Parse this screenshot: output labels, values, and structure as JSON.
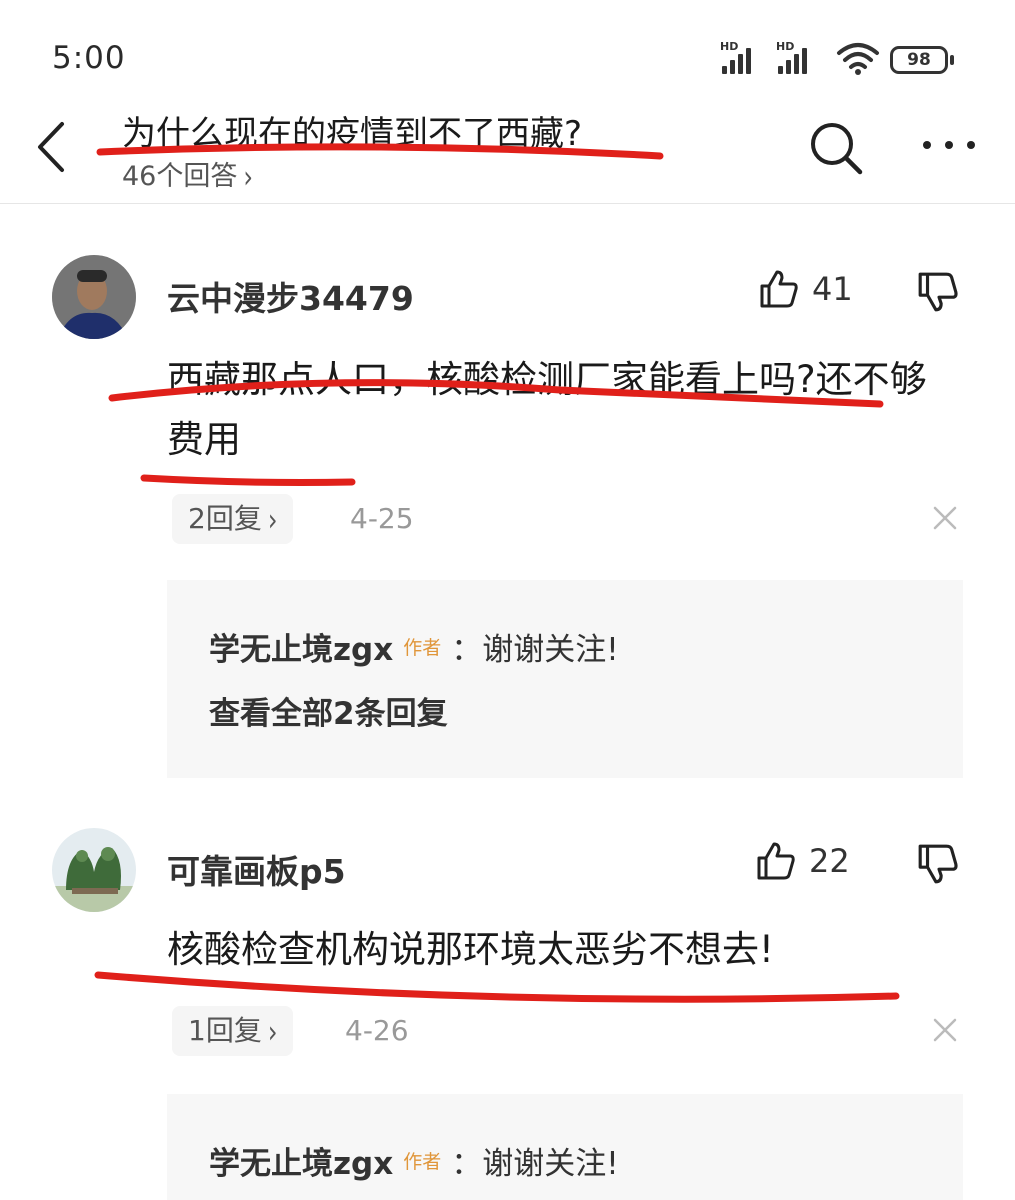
{
  "status_bar": {
    "time": "5:00",
    "signal_1_label": "HD",
    "signal_2_label": "HD",
    "battery": "98"
  },
  "header": {
    "title": "为什么现在的疫情到不了西藏?",
    "answers_count": "46个回答",
    "icons": [
      "back-icon",
      "search-icon",
      "more-icon"
    ]
  },
  "comments": [
    {
      "username": "云中漫步34479",
      "likes": "41",
      "text": "西藏那点人口，核酸检测厂家能看上吗?还不够费用",
      "reply_count": "2回复",
      "date": "4-25",
      "reply": {
        "author": "学无止境zgx",
        "badge": "作者",
        "text": "：谢谢关注!",
        "view_all": "查看全部2条回复"
      }
    },
    {
      "username": "可靠画板p5",
      "likes": "22",
      "text": "核酸检查机构说那环境太恶劣不想去!",
      "reply_count": "1回复",
      "date": "4-26",
      "reply": {
        "author": "学无止境zgx",
        "badge": "作者",
        "text": "：谢谢关注!"
      }
    }
  ],
  "colors": {
    "annotation_red": "#e0201a",
    "author_badge": "#e0963a",
    "reply_box_bg": "#f7f7f7"
  }
}
